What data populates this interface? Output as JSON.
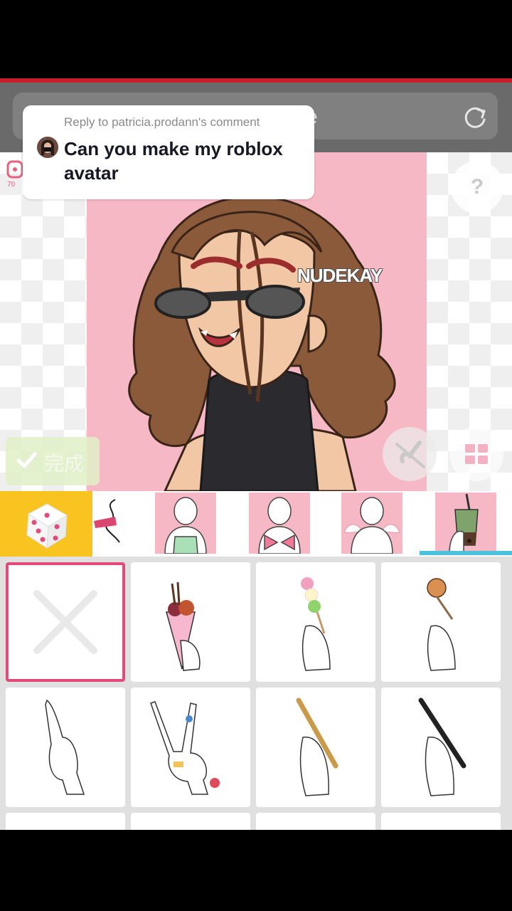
{
  "browser": {
    "url_fragment": "e"
  },
  "comment": {
    "reply_to": "Reply to patricia.prodann's comment",
    "text": "Can you make my roblox avatar"
  },
  "canvas": {
    "watermark": "NUDEKAY",
    "help_label": "?"
  },
  "done_button": {
    "label": "完成"
  },
  "category_tabs": [
    {
      "icon": "dice-icon"
    },
    {
      "icon": "partial-item-thumbnail"
    },
    {
      "icon": "tank-top-body-thumbnail"
    },
    {
      "icon": "bow-top-body-thumbnail"
    },
    {
      "icon": "angel-wings-body-thumbnail"
    },
    {
      "icon": "bubble-tea-hand-thumbnail"
    }
  ],
  "items": [
    {
      "icon": "none-x-icon",
      "selected": true
    },
    {
      "icon": "hand-holding-crepe-icon"
    },
    {
      "icon": "hand-holding-dango-icon"
    },
    {
      "icon": "hand-holding-takoyaki-icon"
    },
    {
      "icon": "hand-pointing-up-icon"
    },
    {
      "icon": "hand-peace-sign-icon"
    },
    {
      "icon": "hand-holding-brush-icon"
    },
    {
      "icon": "hand-holding-pen-icon"
    }
  ],
  "colors": {
    "accent_pink": "#e24a7a",
    "tab_yellow": "#f9c320",
    "tab_indicator": "#4cc3de",
    "artwork_bg": "#f6b8c4",
    "browser_chrome": "#6a6a6a",
    "status_red": "#c81e2c"
  }
}
